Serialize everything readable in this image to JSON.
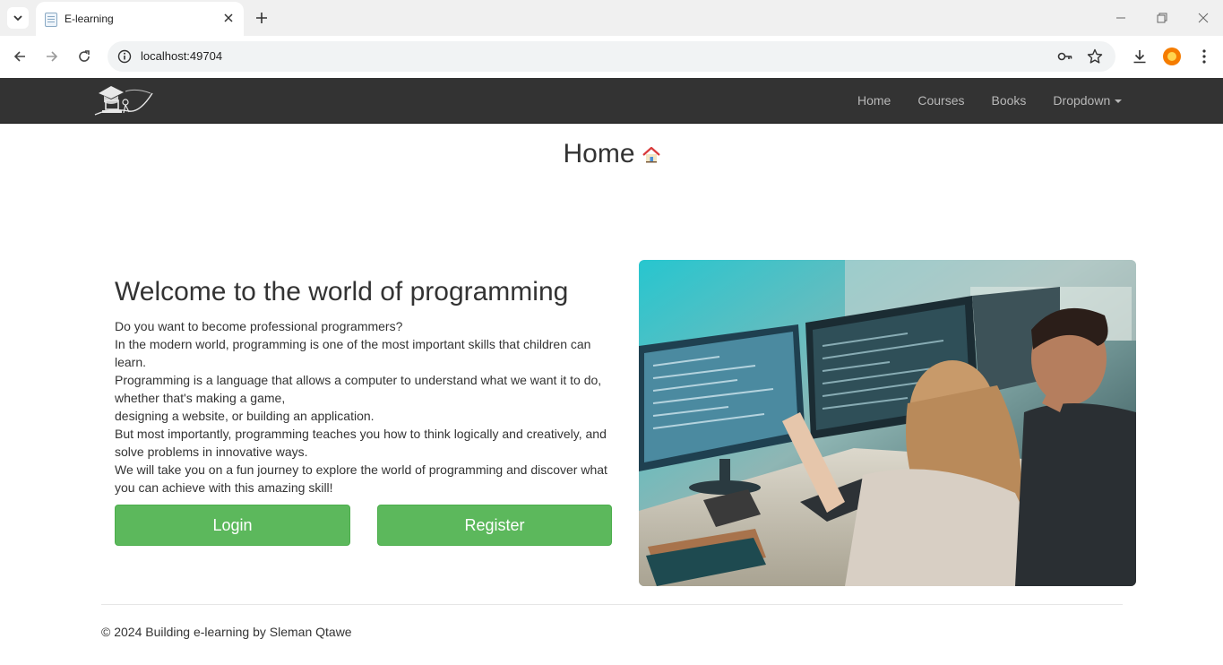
{
  "browser": {
    "tab_title": "E-learning",
    "url": "localhost:49704"
  },
  "navbar": {
    "links": [
      "Home",
      "Courses",
      "Books",
      "Dropdown"
    ]
  },
  "page": {
    "title": "Home",
    "welcome_heading": "Welcome to the world of programming",
    "paragraph_lines": [
      "Do you want to become professional programmers?",
      "In the modern world, programming is one of the most important skills that children can learn.",
      "Programming is a language that allows a computer to understand what we want it to do, whether that's making a game,",
      "designing a website, or building an application.",
      "But most importantly, programming teaches you how to think logically and creatively, and solve problems in innovative ways.",
      "We will take you on a fun journey to explore the world of programming and discover what you can achieve with this amazing skill!"
    ],
    "login_label": "Login",
    "register_label": "Register"
  },
  "footer": {
    "text": "© 2024 Building e-learning by Sleman Qtawe"
  },
  "colors": {
    "navbar_bg": "#333333",
    "button_green": "#5cb85c",
    "nav_link": "#b8b8b8"
  },
  "icons": [
    "tab-search-icon",
    "favicon-icon",
    "close-icon",
    "plus-icon",
    "minimize-icon",
    "restore-icon",
    "window-close-icon",
    "back-icon",
    "forward-icon",
    "reload-icon",
    "info-icon",
    "key-icon",
    "star-icon",
    "download-icon",
    "profile-icon",
    "menu-icon",
    "logo-icon",
    "house-icon"
  ]
}
